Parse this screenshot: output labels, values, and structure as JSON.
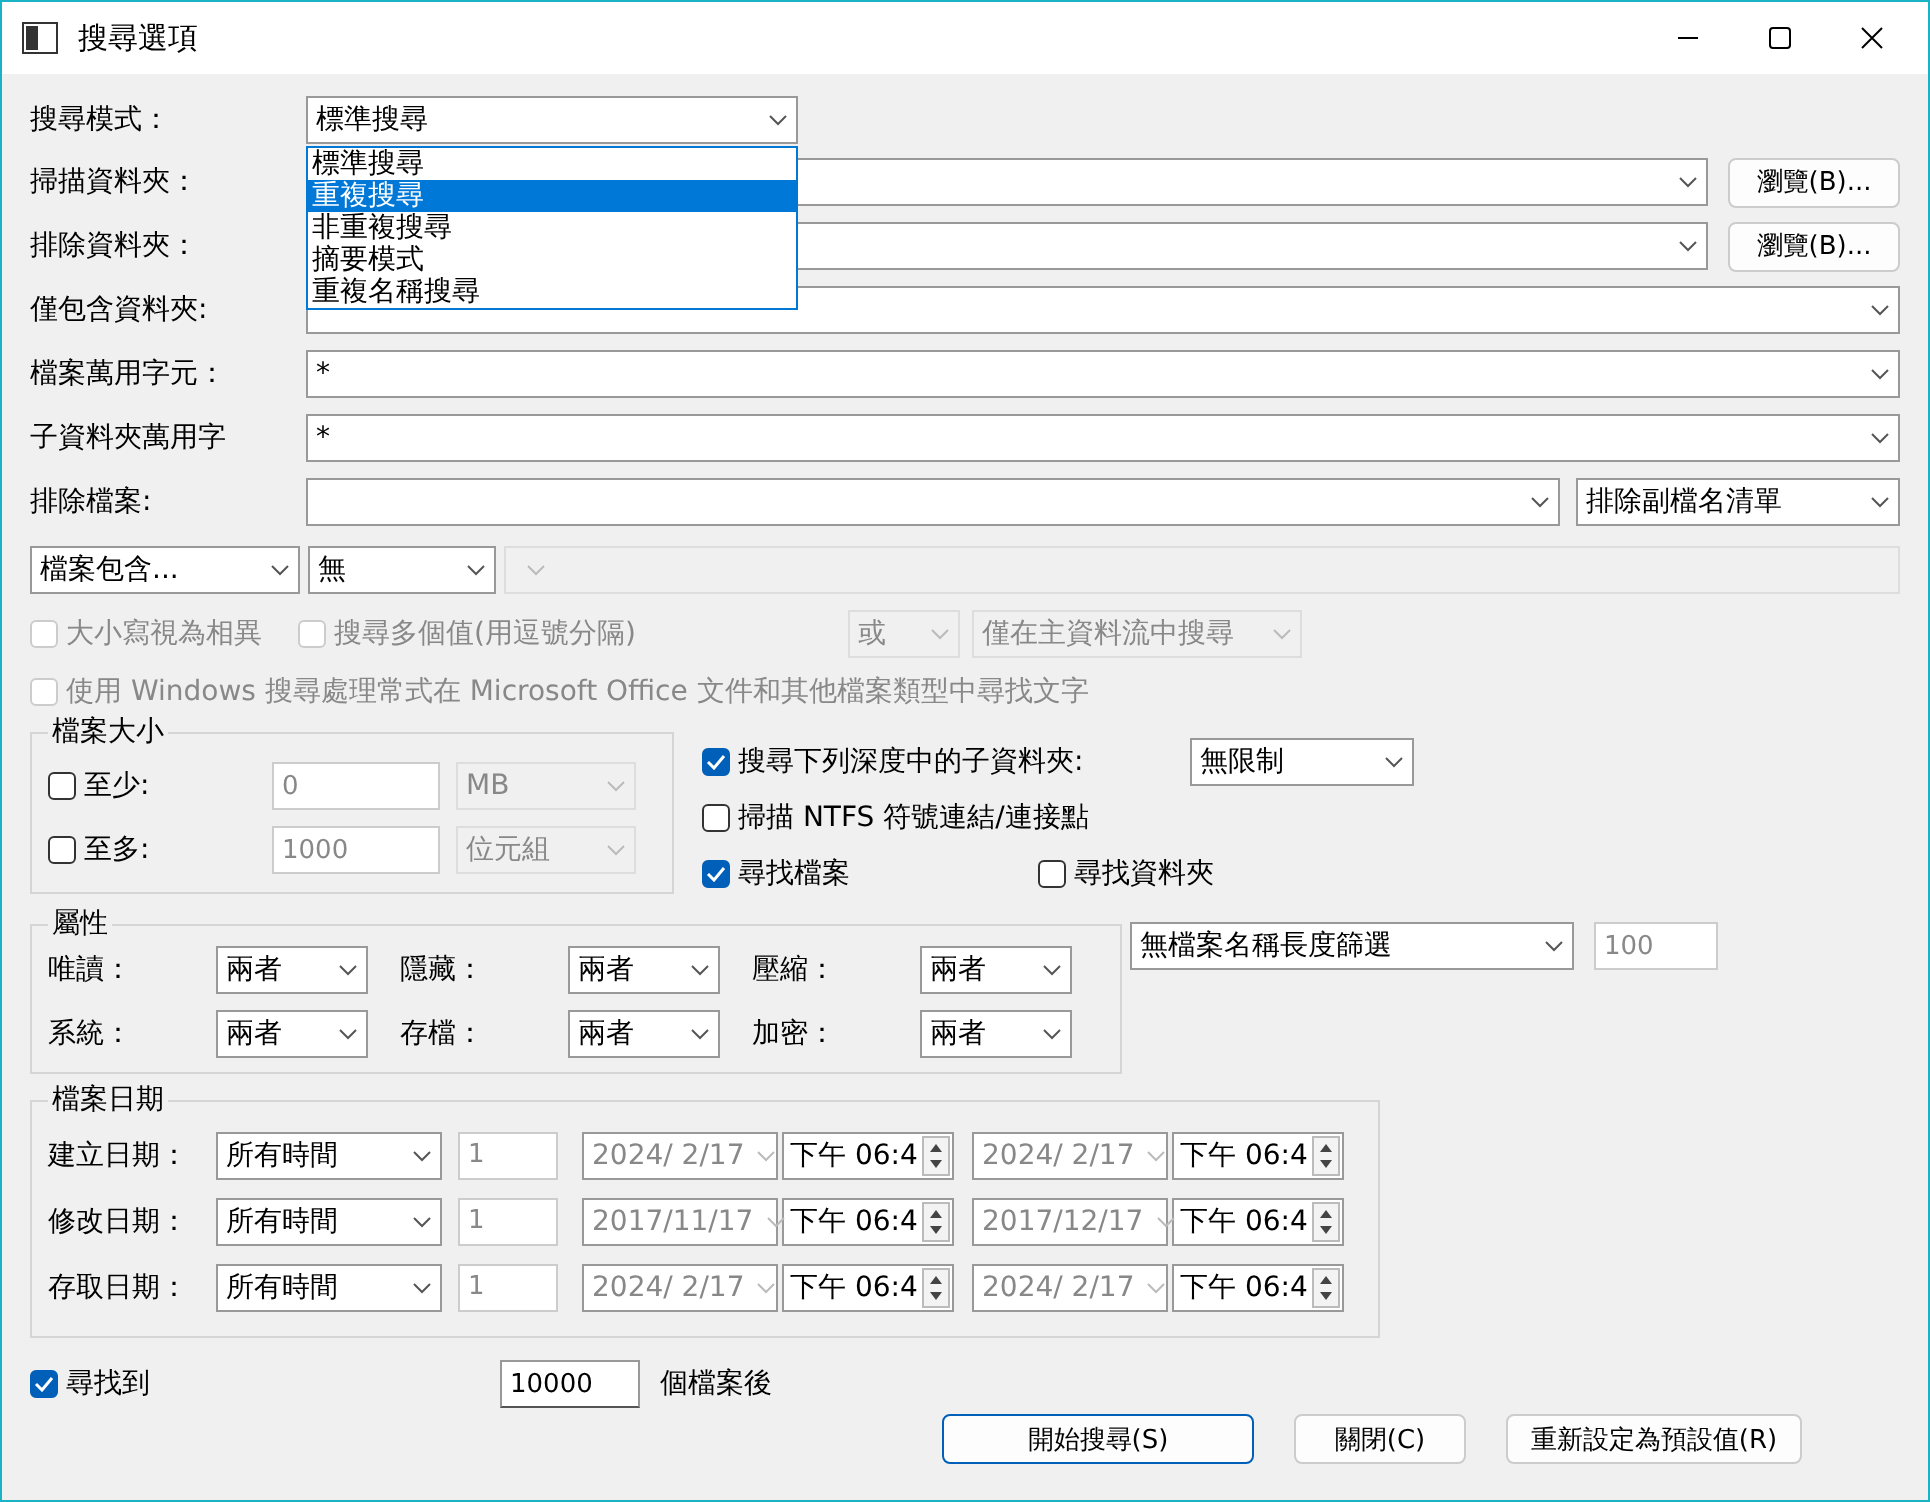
{
  "window": {
    "title": "搜尋選項"
  },
  "search_mode": {
    "label": "搜尋模式：",
    "value": "標準搜尋",
    "expanded": true,
    "options": [
      {
        "label": "標準搜尋",
        "highlighted": false
      },
      {
        "label": "重複搜尋",
        "highlighted": true
      },
      {
        "label": "非重複搜尋",
        "highlighted": false
      },
      {
        "label": "摘要模式",
        "highlighted": false
      },
      {
        "label": "重複名稱搜尋",
        "highlighted": false
      }
    ]
  },
  "fields": [
    {
      "label": "掃描資料夾：",
      "browse": "瀏覽(B)..."
    },
    {
      "label": "排除資料夾：",
      "browse": "瀏覽(B)..."
    },
    {
      "label": "僅包含資料夾:"
    },
    {
      "label": "檔案萬用字元：",
      "value": "*"
    },
    {
      "label": "子資料夾萬用字",
      "value": "*"
    },
    {
      "label": "排除檔案:",
      "extra": "排除副檔名清單"
    }
  ],
  "content_filter": {
    "mode": "檔案包含...",
    "type": "無",
    "text_disabled": true
  },
  "text_options": [
    {
      "label": "大小寫視為相異",
      "checked": false,
      "disabled": true
    },
    {
      "label": "搜尋多個值(用逗號分隔)",
      "checked": false,
      "disabled": true
    }
  ],
  "text_selects": [
    {
      "value": "或",
      "disabled": true
    },
    {
      "value": "僅在主資料流中搜尋",
      "disabled": true
    }
  ],
  "office_option": {
    "label": "使用 Windows 搜尋處理常式在 Microsoft Office 文件和其他檔案類型中尋找文字",
    "checked": false,
    "disabled": true
  },
  "file_size": {
    "title": "檔案大小",
    "rows": [
      {
        "label": "至少:",
        "checked": false,
        "value": "0",
        "unit": "MB"
      },
      {
        "label": "至多:",
        "checked": false,
        "value": "1000",
        "unit": "位元組"
      }
    ]
  },
  "scan_options": [
    {
      "label": "搜尋下列深度中的子資料夾:",
      "checked": true,
      "depth": "無限制"
    },
    {
      "label": "掃描 NTFS 符號連結/連接點",
      "checked": false
    },
    {
      "label": "尋找檔案",
      "checked": true
    },
    {
      "label": "尋找資料夾",
      "checked": false
    }
  ],
  "attributes": {
    "title": "屬性",
    "items": [
      {
        "label": "唯讀：",
        "value": "兩者"
      },
      {
        "label": "隱藏：",
        "value": "兩者"
      },
      {
        "label": "壓縮：",
        "value": "兩者"
      },
      {
        "label": "系統：",
        "value": "兩者"
      },
      {
        "label": "存檔：",
        "value": "兩者"
      },
      {
        "label": "加密：",
        "value": "兩者"
      }
    ]
  },
  "name_length": {
    "filter": "無檔案名稱長度篩選",
    "value": "100",
    "disabled": true
  },
  "file_dates": {
    "title": "檔案日期",
    "rows": [
      {
        "label": "建立日期：",
        "range": "所有時間",
        "count": "1",
        "from_date": "2024/ 2/17",
        "from_time": "下午 06:4",
        "to_date": "2024/ 2/17",
        "to_time": "下午 06:4",
        "disabled": true
      },
      {
        "label": "修改日期：",
        "range": "所有時間",
        "count": "1",
        "from_date": "2017/11/17",
        "from_time": "下午 06:4",
        "to_date": "2017/12/17",
        "to_time": "下午 06:4",
        "disabled": true
      },
      {
        "label": "存取日期：",
        "range": "所有時間",
        "count": "1",
        "from_date": "2024/ 2/17",
        "from_time": "下午 06:4",
        "to_date": "2024/ 2/17",
        "to_time": "下午 06:4",
        "disabled": true
      }
    ]
  },
  "limit": {
    "label": "尋找到",
    "checked": true,
    "value": "10000",
    "suffix": "個檔案後"
  },
  "buttons": [
    {
      "label": "開始搜尋(S)",
      "default": true
    },
    {
      "label": "關閉(C)",
      "default": false
    },
    {
      "label": "重新設定為預設值(R)",
      "default": false
    }
  ]
}
